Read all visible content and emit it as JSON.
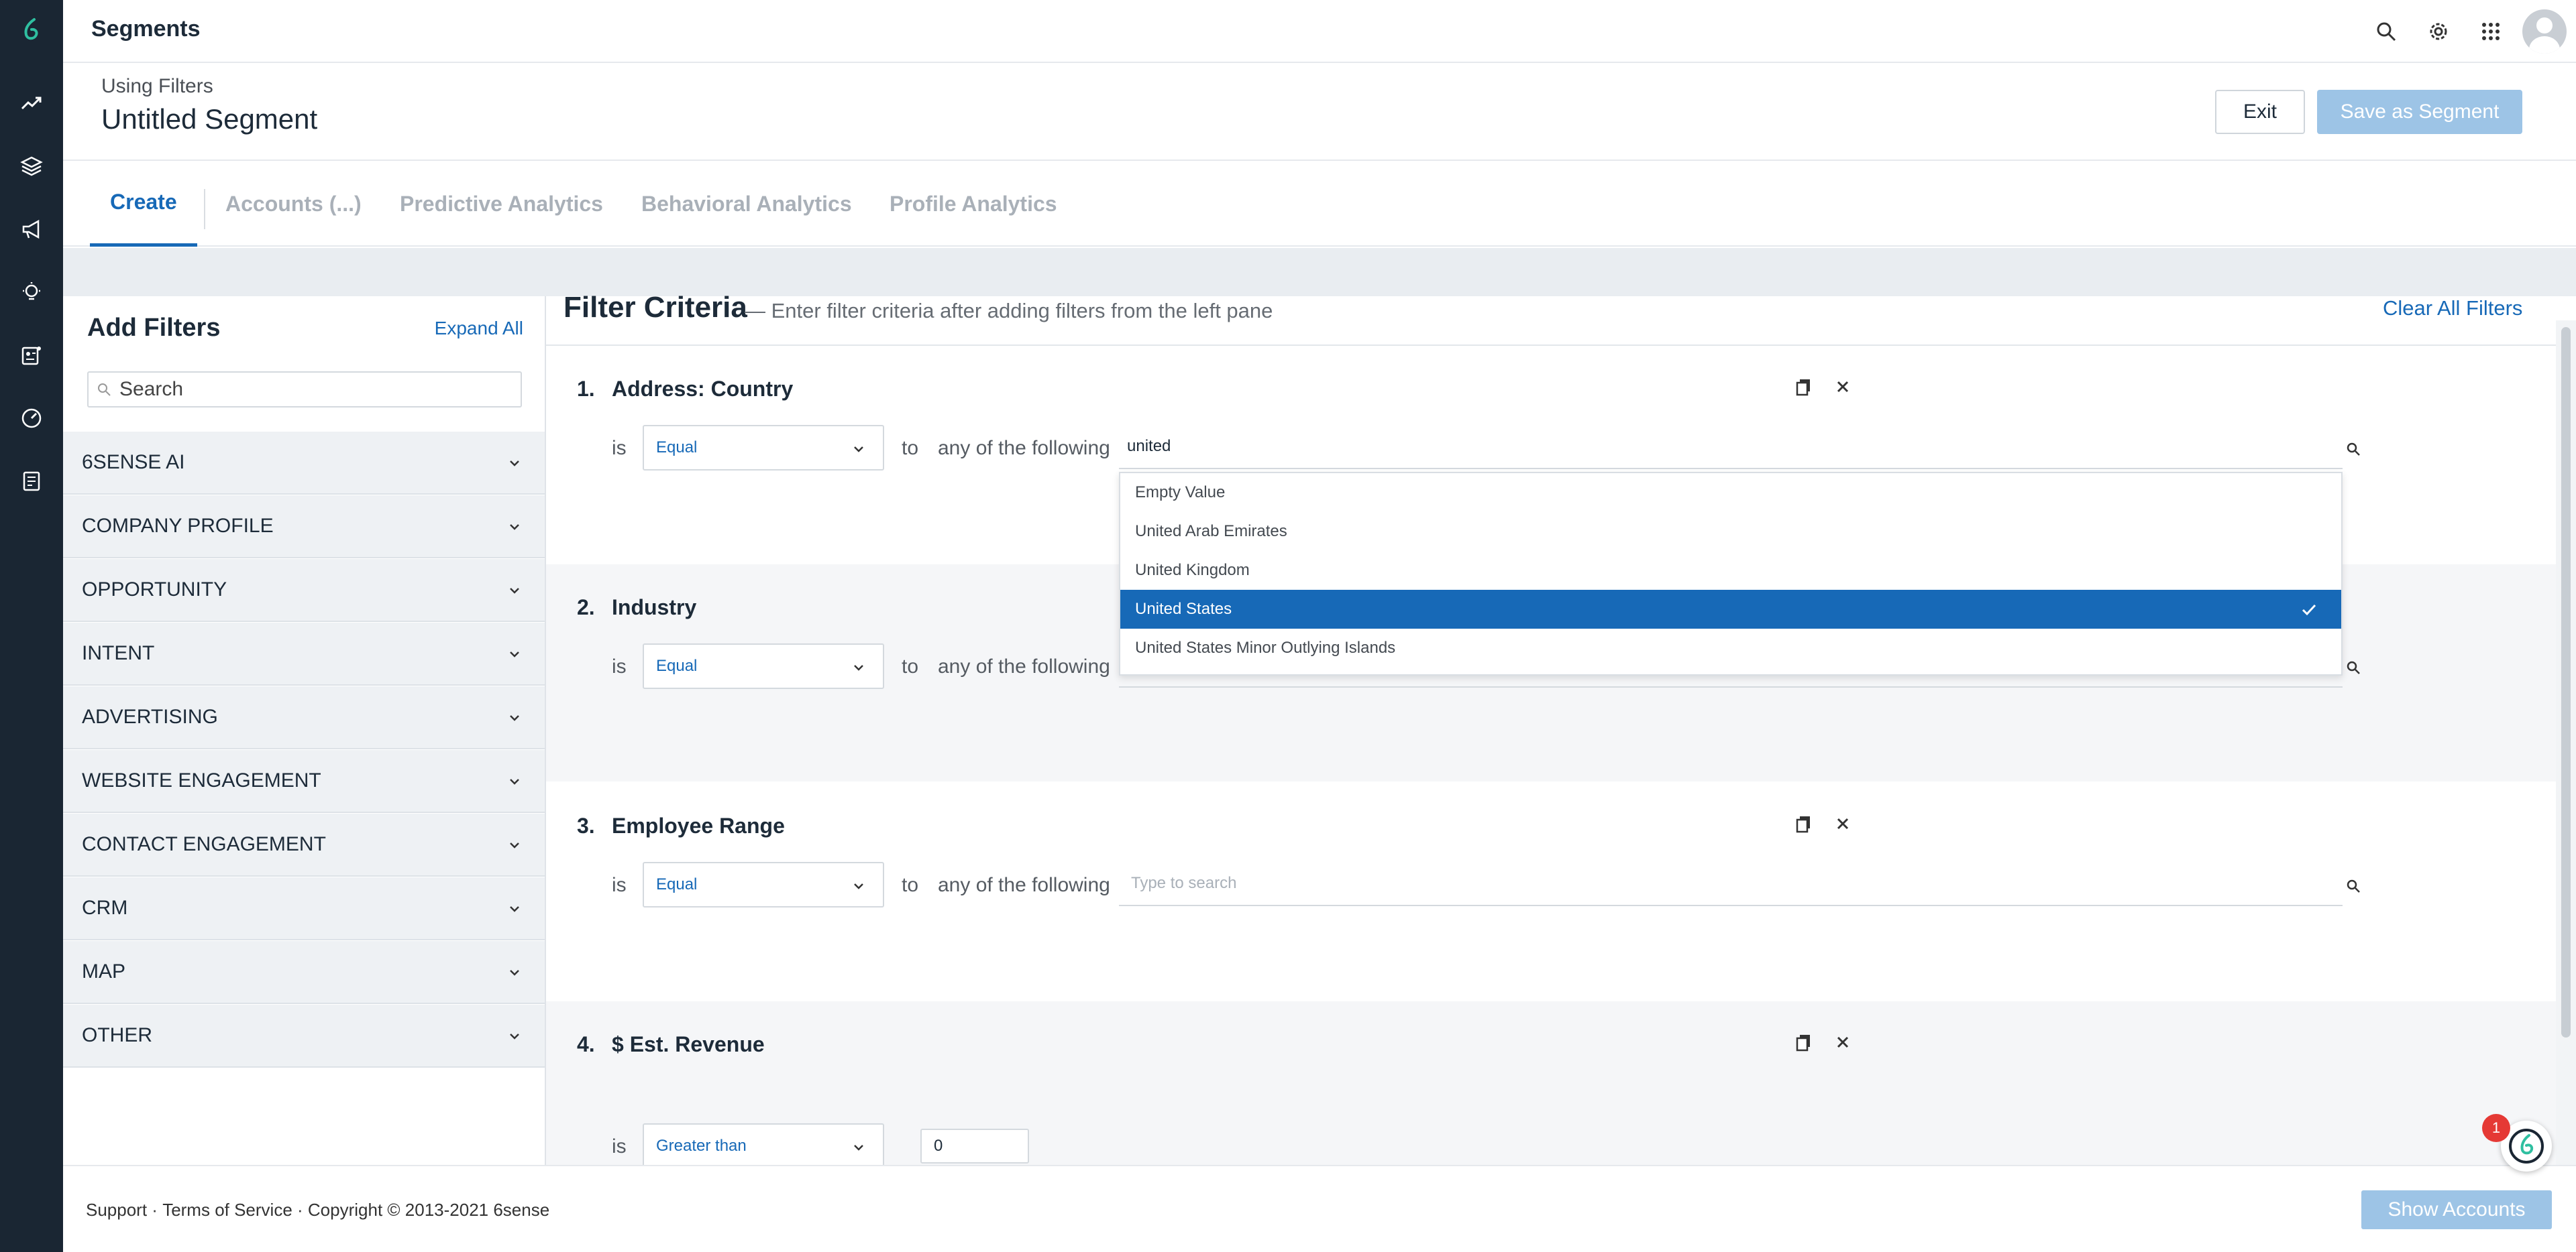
{
  "app": {
    "title": "Segments"
  },
  "rail": {
    "items": [
      "logo-icon",
      "trend-icon",
      "layers-icon",
      "megaphone-icon",
      "lightbulb-icon",
      "profile-card-icon",
      "gauge-icon",
      "report-icon"
    ]
  },
  "topbar": {
    "icons": [
      "search-icon",
      "gear-icon",
      "apps-grid-icon",
      "avatar"
    ]
  },
  "segment": {
    "subtitle": "Using Filters",
    "title": "Untitled Segment",
    "exit_label": "Exit",
    "save_label": "Save as Segment"
  },
  "tabs": [
    {
      "label": "Create",
      "active": true
    },
    {
      "label": "Accounts (...)",
      "active": false
    },
    {
      "label": "Predictive Analytics",
      "active": false
    },
    {
      "label": "Behavioral Analytics",
      "active": false
    },
    {
      "label": "Profile Analytics",
      "active": false
    }
  ],
  "left_panel": {
    "title": "Add Filters",
    "expand_label": "Expand All",
    "search_placeholder": "Search",
    "categories": [
      "6SENSE AI",
      "COMPANY PROFILE",
      "OPPORTUNITY",
      "INTENT",
      "ADVERTISING",
      "WEBSITE ENGAGEMENT",
      "CONTACT ENGAGEMENT",
      "CRM",
      "MAP",
      "OTHER"
    ]
  },
  "criteria": {
    "title": "Filter Criteria",
    "subtitle": "— Enter filter criteria after adding filters from the left pane",
    "clear_label": "Clear All Filters",
    "is_label": "is",
    "to_label": "to",
    "any_label": "any of the following",
    "filters": [
      {
        "number": "1.",
        "name": "Address: Country",
        "operator": "Equal",
        "value": "united",
        "placeholder": ""
      },
      {
        "number": "2.",
        "name": "Industry",
        "operator": "Equal",
        "value": "",
        "placeholder": ""
      },
      {
        "number": "3.",
        "name": "Employee Range",
        "operator": "Equal",
        "value": "",
        "placeholder": "Type to search"
      },
      {
        "number": "4.",
        "name": "$ Est. Revenue",
        "operator": "Greater than",
        "value": "0",
        "placeholder": ""
      }
    ]
  },
  "dropdown": {
    "options": [
      {
        "label": "Empty Value",
        "selected": false
      },
      {
        "label": "United Arab Emirates",
        "selected": false
      },
      {
        "label": "United Kingdom",
        "selected": false
      },
      {
        "label": "United States",
        "selected": true
      },
      {
        "label": "United States Minor Outlying Islands",
        "selected": false
      }
    ]
  },
  "footer": {
    "support": "Support",
    "terms": "Terms of Service",
    "copyright": "Copyright © 2013-2021 6sense",
    "sep": " · ",
    "show_accounts_label": "Show Accounts"
  },
  "help": {
    "badge": "1"
  },
  "colors": {
    "accent": "#1769b7",
    "rail": "#1a2633",
    "selected_row": "#1769b7",
    "disabled_button": "#9dc4e6",
    "badge": "#e53935"
  }
}
